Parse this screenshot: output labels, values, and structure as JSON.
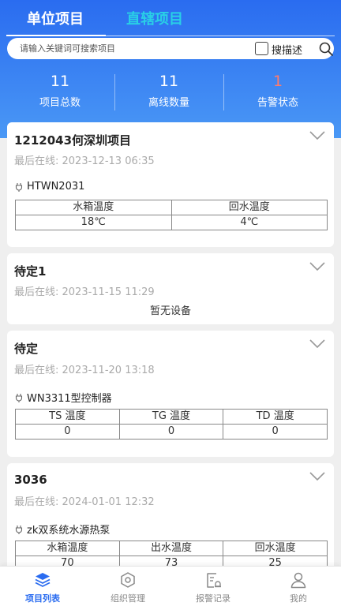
{
  "tabs": {
    "unit": "单位项目",
    "direct": "直辖项目"
  },
  "search": {
    "placeholder": "请输入关键词可搜索项目",
    "checkbox_label": "搜描述"
  },
  "stats": [
    {
      "value": "11",
      "label": "项目总数"
    },
    {
      "value": "11",
      "label": "离线数量"
    },
    {
      "value": "1",
      "label": "告警状态"
    }
  ],
  "projects": [
    {
      "name": "1212043何深圳项目",
      "last_online": "最后在线: 2023-12-13 06:35",
      "device": "HTWN2031",
      "headers": [
        "水箱温度",
        "回水温度"
      ],
      "values": [
        "18℃",
        "4℃"
      ]
    },
    {
      "name": "待定1",
      "last_online": "最后在线: 2023-11-15 11:29",
      "no_device": "暂无设备"
    },
    {
      "name": "待定",
      "last_online": "最后在线: 2023-11-20 13:18",
      "device": "WN3311型控制器",
      "headers": [
        "TS 温度",
        "TG 温度",
        "TD 温度"
      ],
      "values": [
        "0",
        "0",
        "0"
      ]
    },
    {
      "name": "3036",
      "last_online": "最后在线: 2024-01-01 12:32",
      "device": "zk双系统水源热泵",
      "headers": [
        "水箱温度",
        "出水温度",
        "回水温度"
      ],
      "values": [
        "70",
        "73",
        "25"
      ]
    }
  ],
  "nav": [
    {
      "label": "项目列表",
      "icon": "layers-icon",
      "active": true
    },
    {
      "label": "组织管理",
      "icon": "org-icon",
      "active": false
    },
    {
      "label": "报警记录",
      "icon": "alarm-record-icon",
      "active": false
    },
    {
      "label": "我的",
      "icon": "user-icon",
      "active": false
    }
  ],
  "colors": {
    "primary": "#2a6cf0",
    "accent_tab": "#29d0e6",
    "alarm": "#ff7b6b"
  }
}
